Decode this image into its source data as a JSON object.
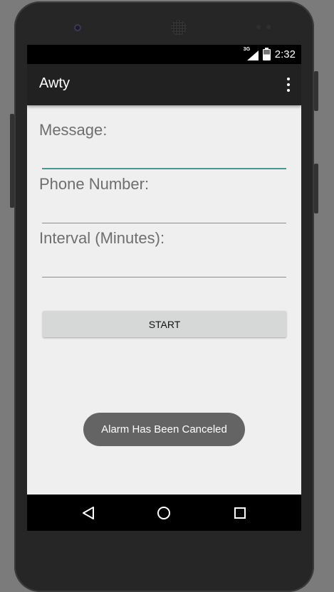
{
  "status_bar": {
    "network": "3G",
    "time": "2:32"
  },
  "app_bar": {
    "title": "Awty",
    "overflow_icon": "more-vert-icon"
  },
  "form": {
    "message_label": "Message:",
    "phone_label": "Phone Number:",
    "interval_label": "Interval (Minutes):",
    "message_value": "",
    "phone_value": "",
    "interval_value": ""
  },
  "start_button": {
    "label": "START"
  },
  "toast": {
    "text": "Alarm Has Been Canceled"
  },
  "nav_bar": {
    "back_icon": "back-icon",
    "home_icon": "home-icon",
    "recents_icon": "recents-icon"
  },
  "colors": {
    "focus_accent": "#3f9c8f",
    "app_bar": "#212121",
    "screen_bg": "#efefef"
  }
}
